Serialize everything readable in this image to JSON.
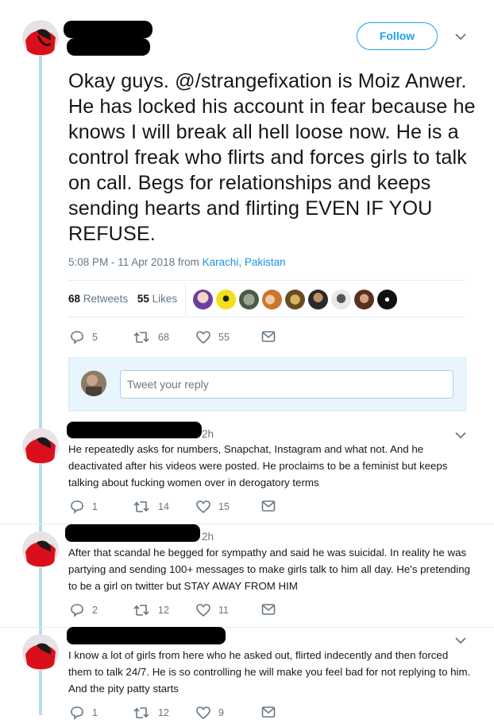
{
  "main_tweet": {
    "follow_label": "Follow",
    "text": "Okay guys. @/strangefixation is Moiz Anwer. He has locked his account in fear because he knows I will break all hell loose now. He is a control freak who flirts and forces girls to talk on call. Begs for relationships and keeps sending hearts and flirting EVEN IF YOU REFUSE.",
    "timestamp": "5:08 PM - 11 Apr 2018 from",
    "location": "Karachi, Pakistan",
    "retweets_count": "68",
    "retweets_label": "Retweets",
    "likes_count": "55",
    "likes_label": "Likes",
    "actions": {
      "replies": "5",
      "retweets": "68",
      "likes": "55"
    }
  },
  "reply_box": {
    "placeholder": "Tweet your reply"
  },
  "replies": [
    {
      "time": "2h",
      "text": "He repeatedly asks for numbers, Snapchat, Instagram and what not. And he deactivated after his videos were posted. He proclaims to be a feminist but keeps talking about fucking women over in derogatory terms",
      "replies": "1",
      "retweets": "14",
      "likes": "15"
    },
    {
      "time": "2h",
      "text": "After that scandal he begged for sympathy and said he was suicidal. In reality he was partying and sending 100+ messages to make girls talk to him all day. He's pretending to be a girl on twitter but STAY AWAY FROM HIM",
      "replies": "2",
      "retweets": "12",
      "likes": "11"
    },
    {
      "time": "",
      "text": "I know a lot of girls from here who he asked out, flirted indecently and then forced them to talk 24/7. He is so controlling he will make you feel bad for not replying to him. And the pity patty starts",
      "replies": "1",
      "retweets": "12",
      "likes": "9"
    }
  ],
  "colors": {
    "accent": "#1da1f2",
    "muted": "#657786",
    "thread_line": "#b8dbe8"
  }
}
